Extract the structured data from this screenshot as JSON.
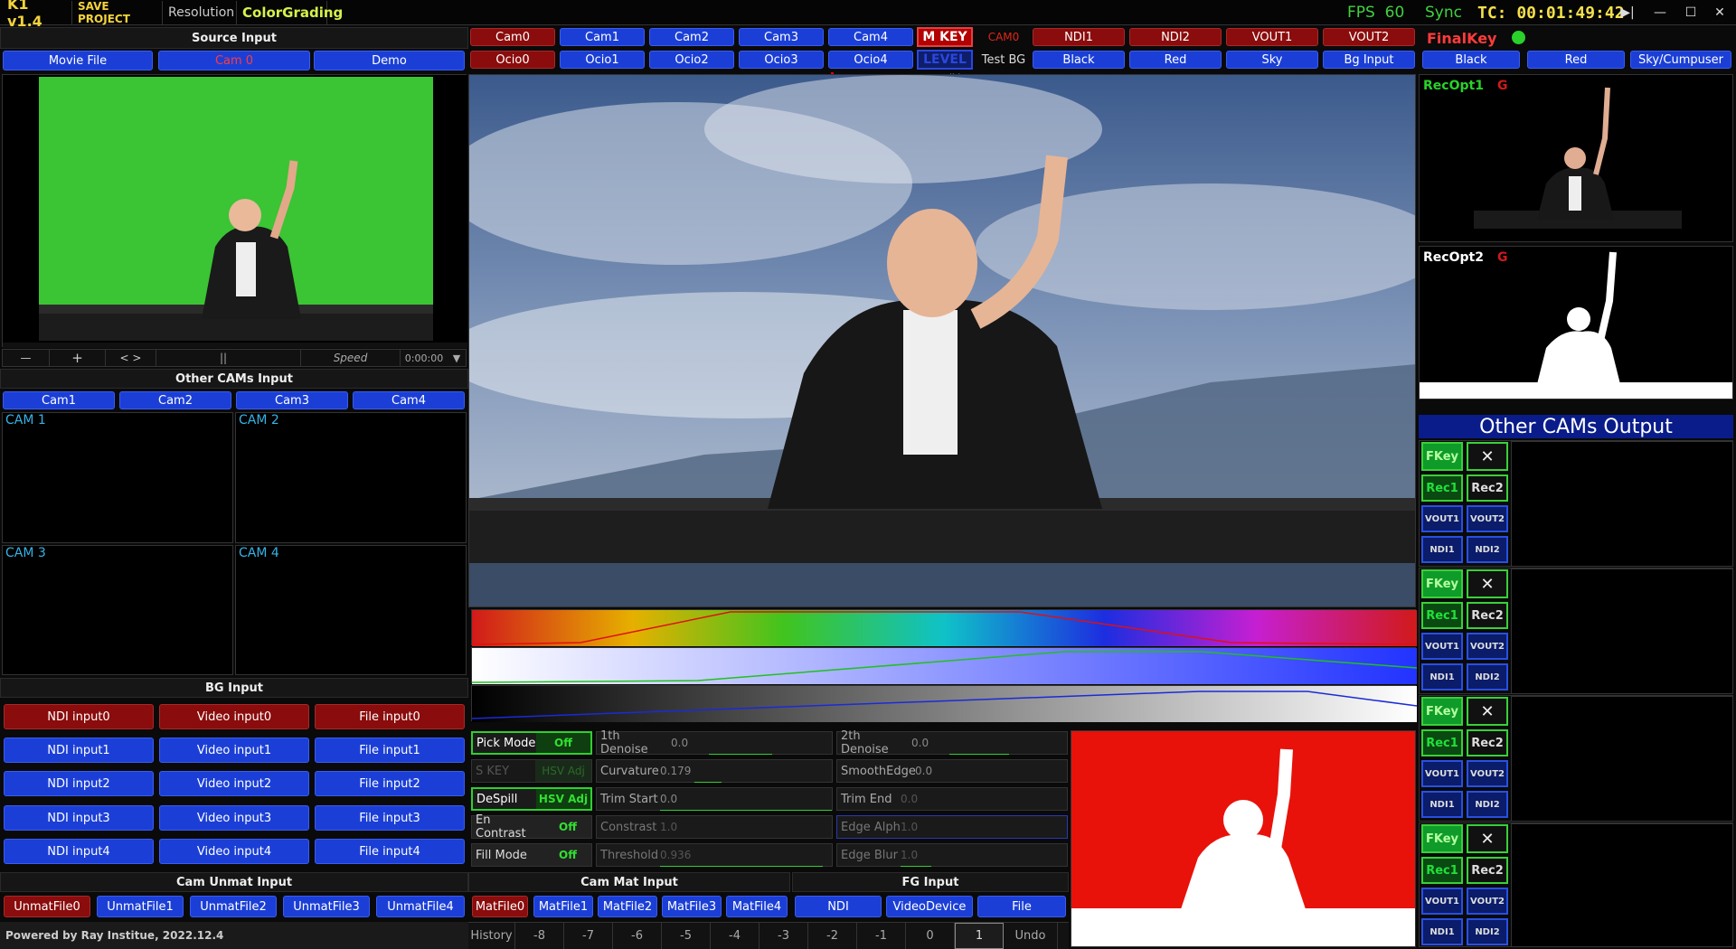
{
  "topbar": {
    "title": "K1 v1.4",
    "save_project": "SAVE PROJECT",
    "resolution": "Resolution",
    "color_grading": "ColorGrading",
    "fps_label": "FPS",
    "fps_value": "60",
    "sync": "Sync",
    "timecode": "TC: 00:01:49:42",
    "win_next": "▶|",
    "win_min": "—",
    "win_max": "☐",
    "win_close": "✕"
  },
  "source_input": {
    "header": "Source Input",
    "buttons": [
      "Movie File",
      "Cam 0",
      "Demo"
    ],
    "transport": {
      "minus": "—",
      "plus": "+",
      "swap": "< >",
      "pause": "||",
      "speed": "Speed",
      "time": "0:00:00",
      "dropdown": "▼"
    }
  },
  "other_cams_input": {
    "header": "Other CAMs Input",
    "buttons": [
      "Cam1",
      "Cam2",
      "Cam3",
      "Cam4"
    ],
    "labels": [
      "CAM 1",
      "CAM 2",
      "CAM 3",
      "CAM 4"
    ]
  },
  "bg_input": {
    "header": "BG Input",
    "rows": [
      [
        "NDI input0",
        "Video input0",
        "File input0"
      ],
      [
        "NDI input1",
        "Video input1",
        "File input1"
      ],
      [
        "NDI input2",
        "Video input2",
        "File input2"
      ],
      [
        "NDI input3",
        "Video input3",
        "File input3"
      ],
      [
        "NDI input4",
        "Video input4",
        "File input4"
      ]
    ]
  },
  "cam_unmat_input": {
    "header": "Cam Unmat Input",
    "buttons": [
      "UnmatFile0",
      "UnmatFile1",
      "UnmatFile2",
      "UnmatFile3",
      "UnmatFile4"
    ]
  },
  "footer": {
    "powered": "Powered by Ray Institue, 2022.12.4"
  },
  "center_top": {
    "cams": [
      "Cam0",
      "Cam1",
      "Cam2",
      "Cam3",
      "Cam4"
    ],
    "ocios": [
      "Ocio0",
      "Ocio1",
      "Ocio2",
      "Ocio3",
      "Ocio4"
    ],
    "m_key": "M KEY",
    "level": "LEVEL",
    "key_slider": "KeySlider",
    "cam0_label": "CAM0",
    "test_bg": "Test BG",
    "outputs_top": [
      "NDI1",
      "NDI2",
      "VOUT1",
      "VOUT2"
    ],
    "outputs_bottom": [
      "Black",
      "Red",
      "Sky",
      "Bg Input"
    ]
  },
  "keying": {
    "pick_mode": {
      "label": "Pick Mode",
      "value": "Off"
    },
    "s_key": {
      "label": "S KEY",
      "value": "HSV Adj"
    },
    "despill": {
      "label": "DeSpill",
      "value": "HSV Adj"
    },
    "en_contrast": {
      "label": "En Contrast",
      "value": "Off"
    },
    "fill_mode": {
      "label": "Fill Mode",
      "value": "Off"
    },
    "params_left": [
      {
        "label": "1th Denoise",
        "value": "0.0"
      },
      {
        "label": "Curvature",
        "value": "0.179"
      },
      {
        "label": "Trim Start",
        "value": "0.0"
      },
      {
        "label": "Constrast",
        "value": "1.0"
      },
      {
        "label": "Threshold",
        "value": "0.936"
      }
    ],
    "params_right": [
      {
        "label": "2th Denoise",
        "value": "0.0"
      },
      {
        "label": "SmoothEdge",
        "value": "0.0"
      },
      {
        "label": "Trim End",
        "value": "0.0"
      },
      {
        "label": "Edge Alph",
        "value": "1.0"
      },
      {
        "label": "Edge Blur",
        "value": "1.0"
      }
    ]
  },
  "cam_mat_input": {
    "header": "Cam Mat Input",
    "buttons": [
      "MatFile0",
      "MatFile1",
      "MatFile2",
      "MatFile3",
      "MatFile4"
    ]
  },
  "fg_input": {
    "header": "FG Input",
    "buttons": [
      "NDI",
      "VideoDevice",
      "File"
    ]
  },
  "history": {
    "label": "History",
    "steps": [
      "-8",
      "-7",
      "-6",
      "-5",
      "-4",
      "-3",
      "-2",
      "-1",
      "0",
      "1"
    ],
    "undo": "Undo"
  },
  "final_key": {
    "label": "FinalKey",
    "buttons": [
      "Black",
      "Red",
      "Sky/Cumpuser"
    ],
    "rec1": "RecOpt1",
    "rec2": "RecOpt2",
    "g": "G"
  },
  "other_cams_output": {
    "header": "Other CAMs Output",
    "fkey": "FKey",
    "close": "✕",
    "rec1": "Rec1",
    "rec2": "Rec2",
    "vout1": "VOUT1",
    "vout2": "VOUT2",
    "ndi1": "NDI1",
    "ndi2": "NDI2"
  }
}
